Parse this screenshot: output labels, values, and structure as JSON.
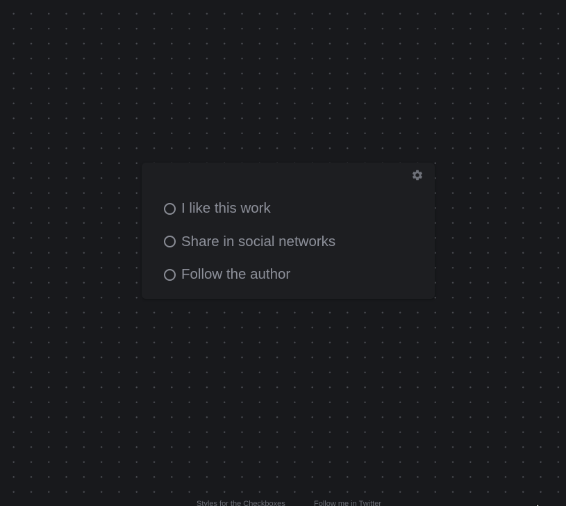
{
  "card": {
    "settings_icon": "gear-icon",
    "items": [
      {
        "label": "I like this work",
        "checked": false
      },
      {
        "label": "Share in social networks",
        "checked": false
      },
      {
        "label": "Follow the author",
        "checked": false
      }
    ]
  },
  "footer": {
    "links": [
      {
        "label": "Styles for the Checkboxes"
      },
      {
        "label": "Follow me in Twitter"
      }
    ]
  },
  "colors": {
    "background": "#18191c",
    "card": "#1d1e21",
    "text": "#8d909a",
    "dot": "#4a4c52"
  }
}
